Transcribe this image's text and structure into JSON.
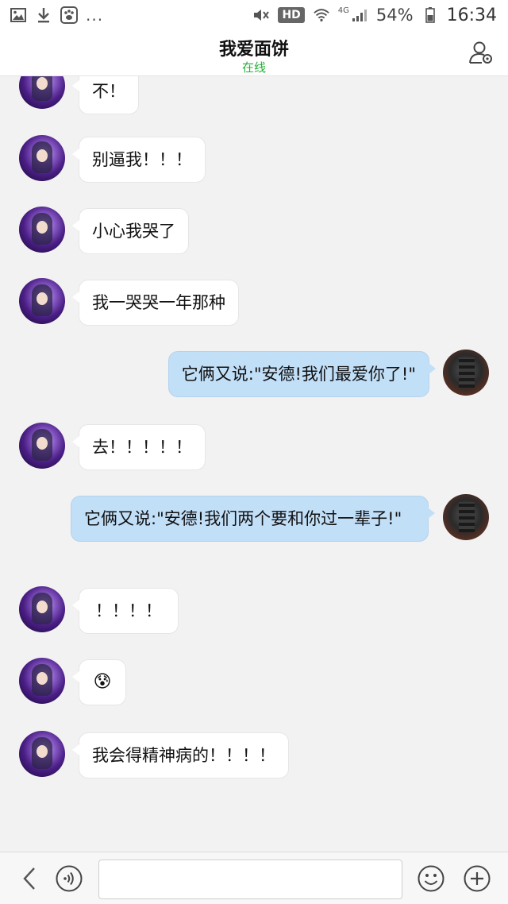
{
  "status_bar": {
    "left_more": "...",
    "hd_badge": "HD",
    "network_type": "4G",
    "battery": "54%",
    "time": "16:34"
  },
  "header": {
    "title": "我爱面饼",
    "status": "在线"
  },
  "messages": [
    {
      "side": "left",
      "text": "不！"
    },
    {
      "side": "left",
      "text": "别逼我！！！"
    },
    {
      "side": "left",
      "text": "小心我哭了"
    },
    {
      "side": "left",
      "text": "我一哭哭一年那种"
    },
    {
      "side": "right",
      "text": "它俩又说:\"安德!我们最爱你了!\""
    },
    {
      "side": "left",
      "text": "去！！！！！"
    },
    {
      "side": "right",
      "text": "它俩又说:\"安德!我们两个要和你过一辈子!\""
    },
    {
      "side": "left",
      "text": "！！！！"
    },
    {
      "side": "left",
      "text": "😰"
    },
    {
      "side": "left",
      "text": "我会得精神病的！！！！"
    }
  ],
  "input": {
    "value": "",
    "placeholder": ""
  },
  "icons": {
    "back": "chevron-left-icon",
    "voice": "voice-icon",
    "emoji": "smiley-icon",
    "plus": "plus-icon",
    "profile": "user-settings-icon"
  },
  "colors": {
    "online_status": "#25b137",
    "sent_bubble": "#c2dff8",
    "received_bubble": "#ffffff",
    "background": "#f2f2f2"
  }
}
